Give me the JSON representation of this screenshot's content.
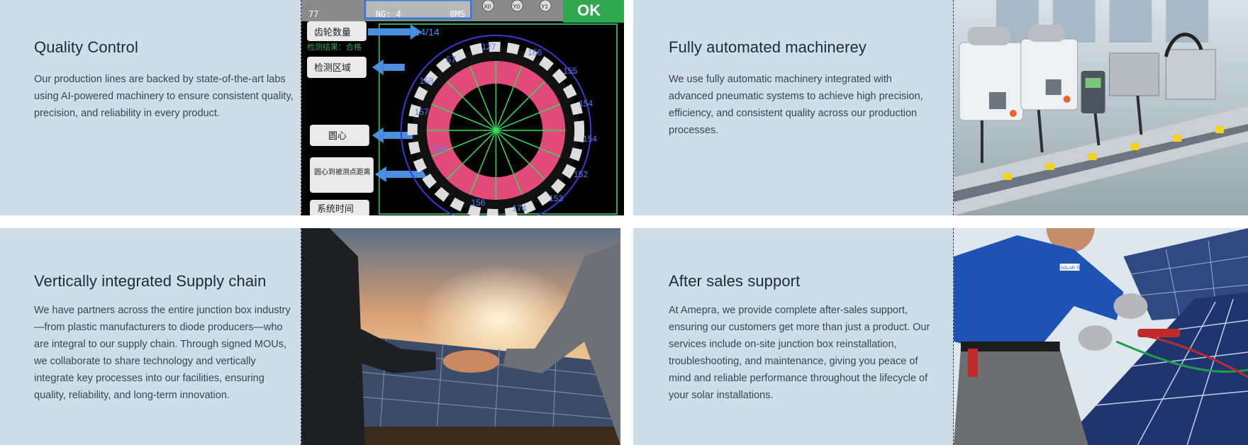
{
  "cards": [
    {
      "title": "Quality Control",
      "body": "Our production lines are backed by state-of-the-art labs using AI-powered machinery to ensure consistent quality, precision, and reliability in every product.",
      "image": "inspection-screen-image"
    },
    {
      "title": "Fully automated machinerey",
      "body": "We use fully automatic machinery integrated with advanced pneumatic systems to achieve high precision, efficiency, and consistent quality across our production processes.",
      "image": "automated-machinery-image"
    },
    {
      "title": "Vertically integrated Supply chain",
      "body": "We have partners across the entire junction box industry—from plastic manufacturers to diode producers—who are integral to our supply chain. Through signed MOUs, we collaborate to share technology and vertically integrate key processes into our facilities, ensuring quality, reliability, and long-term innovation.",
      "image": "handshake-solar-image"
    },
    {
      "title": "After sales support",
      "body": "At Amepra, we provide complete after-sales support, ensuring our customers get more than just a product. Our services include on-site junction box reinstallation, troubleshooting, and maintenance, giving you peace of mind and reliable performance throughout the lifecycle of your solar installations.",
      "image": "technician-solar-image"
    }
  ],
  "inspection_screen": {
    "ok_label": "OK",
    "ng_label": "NG: 4",
    "time_label": "0MS",
    "counter_label": "77",
    "ratio_label": "14/14",
    "result_label": "检测结果：合格",
    "indicators": [
      "X0",
      "Y0",
      "Y1"
    ],
    "side_labels": [
      "齿轮数量",
      "检测区域",
      "圆心",
      "圆心到被测点距离",
      "系统时间"
    ],
    "gear_numbers": [
      "57",
      "127",
      "166",
      "155",
      "154",
      "154",
      "152",
      "153",
      "174",
      "158",
      "157",
      "158",
      "156"
    ]
  },
  "technician_badge": "SOLAR TECH"
}
